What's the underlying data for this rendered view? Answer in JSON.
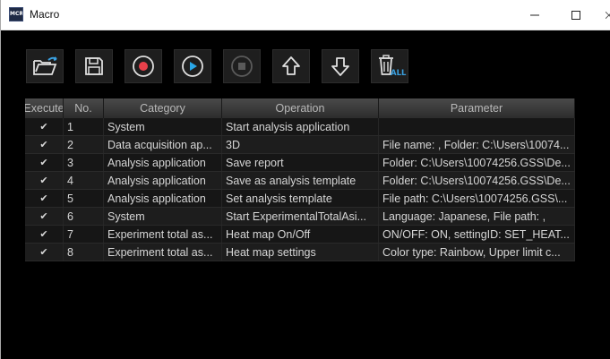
{
  "window": {
    "title": "Macro",
    "app_icon_text": "MCR",
    "controls": {
      "minimize": "—",
      "maximize": "□",
      "close": "✕"
    }
  },
  "toolbar": {
    "buttons": [
      {
        "name": "open-folder",
        "icon": "folder-open-icon"
      },
      {
        "name": "save",
        "icon": "save-icon"
      },
      {
        "name": "record",
        "icon": "record-icon",
        "color": "#e8404a"
      },
      {
        "name": "play",
        "icon": "play-icon",
        "color": "#2aa7e8"
      },
      {
        "name": "stop",
        "icon": "stop-icon",
        "enabled": false
      },
      {
        "name": "move-up",
        "icon": "arrow-up-icon"
      },
      {
        "name": "move-down",
        "icon": "arrow-down-icon"
      },
      {
        "name": "delete-all",
        "icon": "trash-all-icon",
        "badge": "ALL"
      }
    ]
  },
  "table": {
    "headers": {
      "execute": "Execute",
      "no": "No.",
      "category": "Category",
      "operation": "Operation",
      "parameter": "Parameter"
    },
    "rows": [
      {
        "check": "✔",
        "no": "1",
        "category": "System",
        "operation": "Start analysis application",
        "parameter": ""
      },
      {
        "check": "✔",
        "no": "2",
        "category": "Data acquisition ap...",
        "operation": "3D",
        "parameter": "File name: , Folder: C:\\Users\\10074..."
      },
      {
        "check": "✔",
        "no": "3",
        "category": "Analysis application",
        "operation": "Save report",
        "parameter": "Folder: C:\\Users\\10074256.GSS\\De..."
      },
      {
        "check": "✔",
        "no": "4",
        "category": "Analysis application",
        "operation": "Save as analysis template",
        "parameter": "Folder: C:\\Users\\10074256.GSS\\De..."
      },
      {
        "check": "✔",
        "no": "5",
        "category": "Analysis application",
        "operation": "Set analysis template",
        "parameter": "File path: C:\\Users\\10074256.GSS\\..."
      },
      {
        "check": "✔",
        "no": "6",
        "category": "System",
        "operation": "Start ExperimentalTotalAsi...",
        "parameter": "Language: Japanese, File path: ,"
      },
      {
        "check": "✔",
        "no": "7",
        "category": "Experiment total as...",
        "operation": "Heat map On/Off",
        "parameter": "ON/OFF: ON, settingID: SET_HEAT..."
      },
      {
        "check": "✔",
        "no": "8",
        "category": "Experiment total as...",
        "operation": "Heat map settings",
        "parameter": "Color type: Rainbow, Upper limit c..."
      }
    ]
  },
  "colors": {
    "background": "#000000",
    "record": "#e8404a",
    "play": "#2aa7e8",
    "badge": "#3aa0e0"
  }
}
